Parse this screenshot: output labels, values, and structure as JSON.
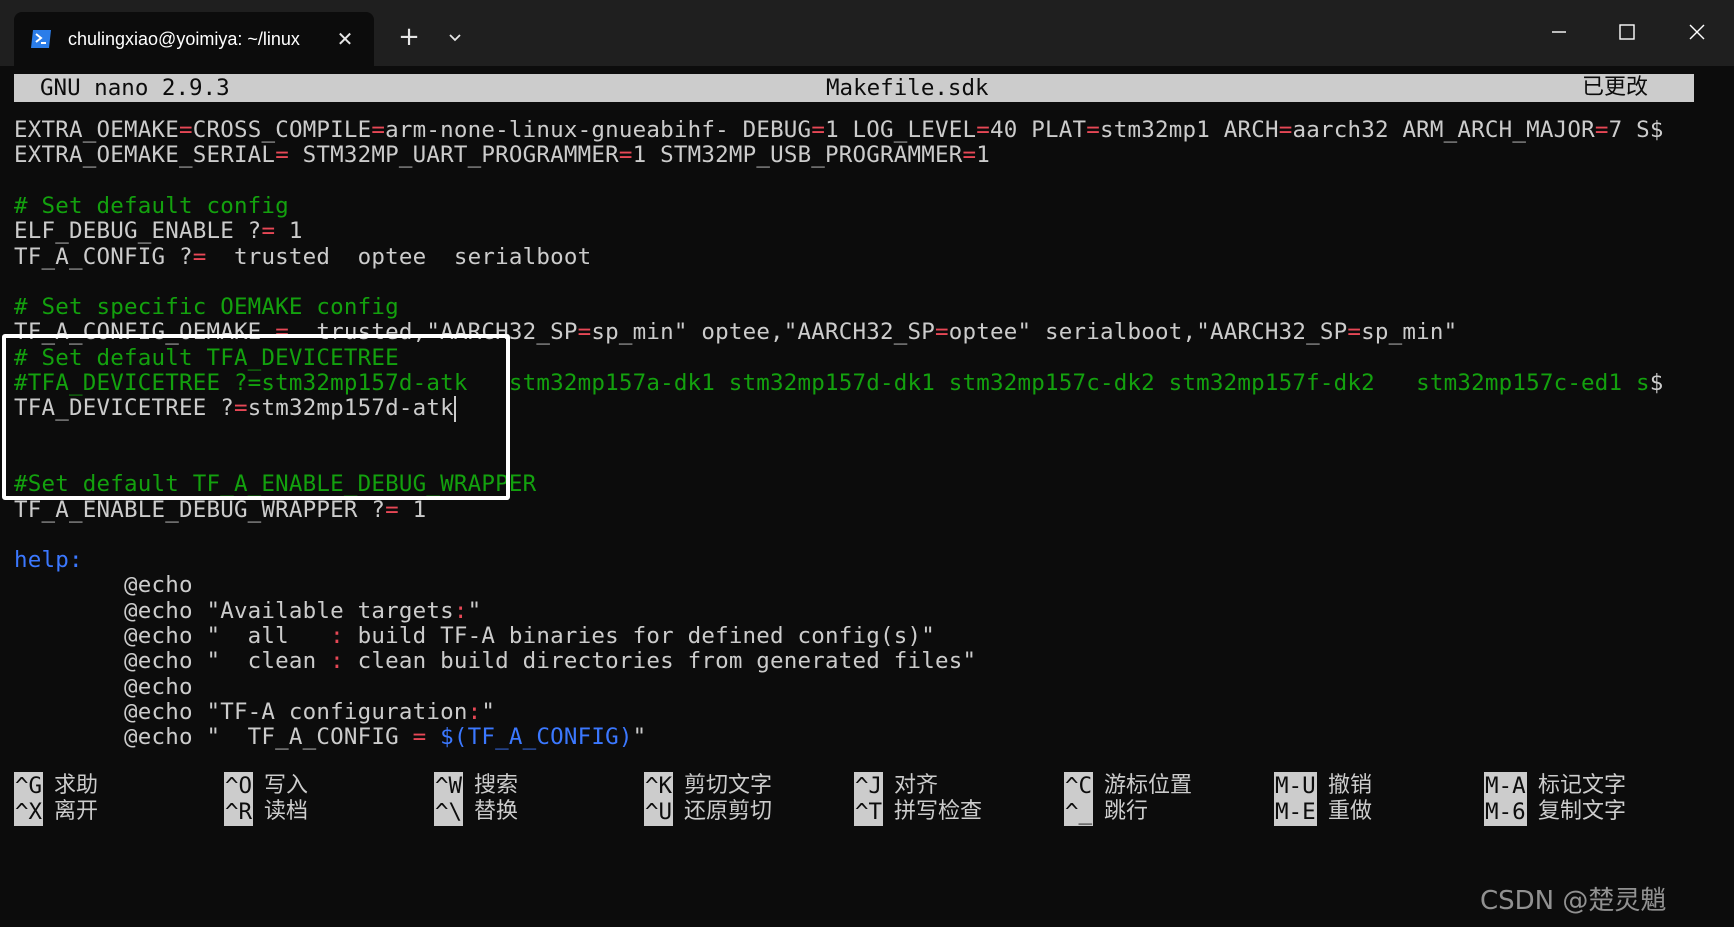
{
  "window": {
    "tab_title": "chulingxiao@yoimiya: ~/linux",
    "tab_close": "✕",
    "new_tab": "+",
    "colors": {
      "titlebar": "#1f1f1f",
      "terminal_bg": "#0c0c0c",
      "comment": "#13a10e",
      "operator": "#e74856",
      "keyword": "#3b78ff"
    }
  },
  "nano": {
    "version": "GNU nano 2.9.3",
    "filename": "Makefile.sdk",
    "modified": "已更改"
  },
  "lines": [
    {
      "segs": [
        [
          "EXTRA_OEMAKE",
          ""
        ],
        [
          "=",
          "r"
        ],
        [
          "CROSS_COMPILE",
          ""
        ],
        [
          "=",
          "r"
        ],
        [
          "arm-none-linux-gnueabihf- DEBUG",
          ""
        ],
        [
          "=",
          "r"
        ],
        [
          "1 LOG_LEVEL",
          ""
        ],
        [
          "=",
          "r"
        ],
        [
          "40 PLAT",
          ""
        ],
        [
          "=",
          "r"
        ],
        [
          "stm32mp1 ARCH",
          ""
        ],
        [
          "=",
          "r"
        ],
        [
          "aarch32 ARM_ARCH_MAJOR",
          ""
        ],
        [
          "=",
          "r"
        ],
        [
          "7 S$",
          ""
        ]
      ]
    },
    {
      "segs": [
        [
          "EXTRA_OEMAKE_SERIAL",
          ""
        ],
        [
          "=",
          "r"
        ],
        [
          " STM32MP_UART_PROGRAMMER",
          ""
        ],
        [
          "=",
          "r"
        ],
        [
          "1 STM32MP_USB_PROGRAMMER",
          ""
        ],
        [
          "=",
          "r"
        ],
        [
          "1",
          ""
        ]
      ]
    },
    {
      "segs": []
    },
    {
      "segs": [
        [
          "# Set default config",
          "g"
        ]
      ]
    },
    {
      "segs": [
        [
          "ELF_DEBUG_ENABLE ?",
          ""
        ],
        [
          "=",
          "r"
        ],
        [
          " 1",
          ""
        ]
      ]
    },
    {
      "segs": [
        [
          "TF_A_CONFIG ?",
          ""
        ],
        [
          "=",
          "r"
        ],
        [
          "  trusted  optee  serialboot",
          ""
        ]
      ]
    },
    {
      "segs": []
    },
    {
      "segs": [
        [
          "# Set specific OEMAKE config",
          "g"
        ]
      ]
    },
    {
      "segs": [
        [
          "TF_A_CONFIG_OEMAKE ",
          ""
        ],
        [
          "=",
          "r"
        ],
        [
          "  trusted,\"AARCH32_SP",
          ""
        ],
        [
          "=",
          "r"
        ],
        [
          "sp_min\" optee,\"AARCH32_SP",
          ""
        ],
        [
          "=",
          "r"
        ],
        [
          "optee\" serialboot,\"AARCH32_SP",
          ""
        ],
        [
          "=",
          "r"
        ],
        [
          "sp_min\"",
          ""
        ]
      ]
    },
    {
      "segs": [
        [
          "# Set default TFA_DEVICETREE",
          "g"
        ]
      ]
    },
    {
      "segs": [
        [
          "#TFA_DEVICETREE ?=stm32mp157d-atk   stm32mp157a-dk1 stm32mp157d-dk1 stm32mp157c-dk2 stm32mp157f-dk2   stm32mp157c-ed1 s",
          "g"
        ],
        [
          "$",
          ""
        ]
      ]
    },
    {
      "segs": [
        [
          "TFA_DEVICETREE ?",
          ""
        ],
        [
          "=",
          "r"
        ],
        [
          "stm32mp157d-atk",
          ""
        ]
      ],
      "cursor": true
    },
    {
      "segs": []
    },
    {
      "segs": []
    },
    {
      "segs": [
        [
          "#Set default TF_A_ENABLE_DEBUG_WRAPPER",
          "g"
        ]
      ]
    },
    {
      "segs": [
        [
          "TF_A_ENABLE_DEBUG_WRAPPER ?",
          ""
        ],
        [
          "=",
          "r"
        ],
        [
          " 1",
          ""
        ]
      ]
    },
    {
      "segs": []
    },
    {
      "segs": [
        [
          "help:",
          "b"
        ]
      ]
    },
    {
      "segs": [
        [
          "        @echo",
          ""
        ]
      ]
    },
    {
      "segs": [
        [
          "        @echo \"Available targets",
          ""
        ],
        [
          ":",
          "r"
        ],
        [
          "\"",
          ""
        ]
      ]
    },
    {
      "segs": [
        [
          "        @echo \"  all   ",
          ""
        ],
        [
          ":",
          "r"
        ],
        [
          " build TF-A binaries for defined config(s)\"",
          ""
        ]
      ]
    },
    {
      "segs": [
        [
          "        @echo \"  clean ",
          ""
        ],
        [
          ":",
          "r"
        ],
        [
          " clean build directories from generated files\"",
          ""
        ]
      ]
    },
    {
      "segs": [
        [
          "        @echo",
          ""
        ]
      ]
    },
    {
      "segs": [
        [
          "        @echo \"TF-A configuration",
          ""
        ],
        [
          ":",
          "r"
        ],
        [
          "\"",
          ""
        ]
      ]
    },
    {
      "segs": [
        [
          "        @echo \"  TF_A_CONFIG ",
          ""
        ],
        [
          "=",
          "r"
        ],
        [
          " ",
          ""
        ],
        [
          "$(TF_A_CONFIG)",
          "b"
        ],
        [
          "\"",
          ""
        ]
      ]
    }
  ],
  "shortcuts": {
    "row1": [
      {
        "key": "^G",
        "label": "求助",
        "name": "help"
      },
      {
        "key": "^O",
        "label": "写入",
        "name": "write-out"
      },
      {
        "key": "^W",
        "label": "搜索",
        "name": "where-is"
      },
      {
        "key": "^K",
        "label": "剪切文字",
        "name": "cut-text"
      },
      {
        "key": "^J",
        "label": "对齐",
        "name": "justify"
      },
      {
        "key": "^C",
        "label": "游标位置",
        "name": "cursor-position"
      },
      {
        "key": "M-U",
        "label": "撤销",
        "name": "undo"
      },
      {
        "key": "M-A",
        "label": "标记文字",
        "name": "mark-text"
      }
    ],
    "row2": [
      {
        "key": "^X",
        "label": "离开",
        "name": "exit"
      },
      {
        "key": "^R",
        "label": "读档",
        "name": "read-file"
      },
      {
        "key": "^\\",
        "label": "替换",
        "name": "replace"
      },
      {
        "key": "^U",
        "label": "还原剪切",
        "name": "uncut-text"
      },
      {
        "key": "^T",
        "label": "拼写检查",
        "name": "spell-check"
      },
      {
        "key": "^_",
        "label": "跳行",
        "name": "go-to-line"
      },
      {
        "key": "M-E",
        "label": "重做",
        "name": "redo"
      },
      {
        "key": "M-6",
        "label": "复制文字",
        "name": "copy-text"
      }
    ]
  },
  "watermark": "CSDN @楚灵魈"
}
